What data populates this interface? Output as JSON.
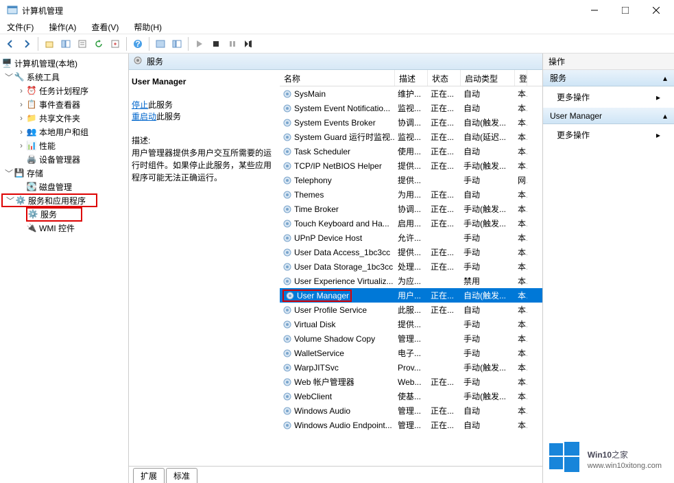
{
  "window": {
    "title": "计算机管理"
  },
  "menu": {
    "file": "文件(F)",
    "action": "操作(A)",
    "view": "查看(V)",
    "help": "帮助(H)"
  },
  "tree": {
    "root": "计算机管理(本地)",
    "system_tools": "系统工具",
    "task_scheduler": "任务计划程序",
    "event_viewer": "事件查看器",
    "shared_folders": "共享文件夹",
    "local_users": "本地用户和组",
    "performance": "性能",
    "device_manager": "设备管理器",
    "storage": "存储",
    "disk_mgmt": "磁盘管理",
    "services_apps": "服务和应用程序",
    "services": "服务",
    "wmi": "WMI 控件"
  },
  "services_header": "服务",
  "detail": {
    "name": "User Manager",
    "stop_label": "停止",
    "stop_suffix": "此服务",
    "restart_label": "重启动",
    "restart_suffix": "此服务",
    "desc_label": "描述:",
    "desc_text": "用户管理器提供多用户交互所需要的运行时组件。如果停止此服务，某些应用程序可能无法正确运行。"
  },
  "columns": {
    "name": "名称",
    "desc": "描述",
    "state": "状态",
    "startup": "启动类型",
    "logon": "登"
  },
  "services": [
    {
      "name": "SysMain",
      "desc": "维护...",
      "state": "正在...",
      "startup": "自动",
      "logon": "本"
    },
    {
      "name": "System Event Notificatio...",
      "desc": "监视...",
      "state": "正在...",
      "startup": "自动",
      "logon": "本"
    },
    {
      "name": "System Events Broker",
      "desc": "协调...",
      "state": "正在...",
      "startup": "自动(触发...",
      "logon": "本"
    },
    {
      "name": "System Guard 运行时监视...",
      "desc": "监视...",
      "state": "正在...",
      "startup": "自动(延迟...",
      "logon": "本"
    },
    {
      "name": "Task Scheduler",
      "desc": "使用...",
      "state": "正在...",
      "startup": "自动",
      "logon": "本"
    },
    {
      "name": "TCP/IP NetBIOS Helper",
      "desc": "提供...",
      "state": "正在...",
      "startup": "手动(触发...",
      "logon": "本"
    },
    {
      "name": "Telephony",
      "desc": "提供...",
      "state": "",
      "startup": "手动",
      "logon": "网"
    },
    {
      "name": "Themes",
      "desc": "为用...",
      "state": "正在...",
      "startup": "自动",
      "logon": "本"
    },
    {
      "name": "Time Broker",
      "desc": "协调...",
      "state": "正在...",
      "startup": "手动(触发...",
      "logon": "本"
    },
    {
      "name": "Touch Keyboard and Ha...",
      "desc": "启用...",
      "state": "正在...",
      "startup": "手动(触发...",
      "logon": "本"
    },
    {
      "name": "UPnP Device Host",
      "desc": "允许...",
      "state": "",
      "startup": "手动",
      "logon": "本"
    },
    {
      "name": "User Data Access_1bc3cc",
      "desc": "提供...",
      "state": "正在...",
      "startup": "手动",
      "logon": "本"
    },
    {
      "name": "User Data Storage_1bc3cc",
      "desc": "处理...",
      "state": "正在...",
      "startup": "手动",
      "logon": "本"
    },
    {
      "name": "User Experience Virtualiz...",
      "desc": "为应...",
      "state": "",
      "startup": "禁用",
      "logon": "本"
    },
    {
      "name": "User Manager",
      "desc": "用户...",
      "state": "正在...",
      "startup": "自动(触发...",
      "logon": "本",
      "selected": true
    },
    {
      "name": "User Profile Service",
      "desc": "此服...",
      "state": "正在...",
      "startup": "自动",
      "logon": "本"
    },
    {
      "name": "Virtual Disk",
      "desc": "提供...",
      "state": "",
      "startup": "手动",
      "logon": "本"
    },
    {
      "name": "Volume Shadow Copy",
      "desc": "管理...",
      "state": "",
      "startup": "手动",
      "logon": "本"
    },
    {
      "name": "WalletService",
      "desc": "电子...",
      "state": "",
      "startup": "手动",
      "logon": "本"
    },
    {
      "name": "WarpJITSvc",
      "desc": "Prov...",
      "state": "",
      "startup": "手动(触发...",
      "logon": "本"
    },
    {
      "name": "Web 帐户管理器",
      "desc": "Web...",
      "state": "正在...",
      "startup": "手动",
      "logon": "本"
    },
    {
      "name": "WebClient",
      "desc": "使基...",
      "state": "",
      "startup": "手动(触发...",
      "logon": "本"
    },
    {
      "name": "Windows Audio",
      "desc": "管理...",
      "state": "正在...",
      "startup": "自动",
      "logon": "本"
    },
    {
      "name": "Windows Audio Endpoint...",
      "desc": "管理...",
      "state": "正在...",
      "startup": "自动",
      "logon": "本"
    }
  ],
  "tabs": {
    "extended": "扩展",
    "standard": "标准"
  },
  "actions": {
    "header": "操作",
    "section1": "服务",
    "more1": "更多操作",
    "section2": "User Manager",
    "more2": "更多操作"
  },
  "watermark": {
    "brand_a": "Win10",
    "brand_b": "之家",
    "url": "www.win10xitong.com"
  }
}
